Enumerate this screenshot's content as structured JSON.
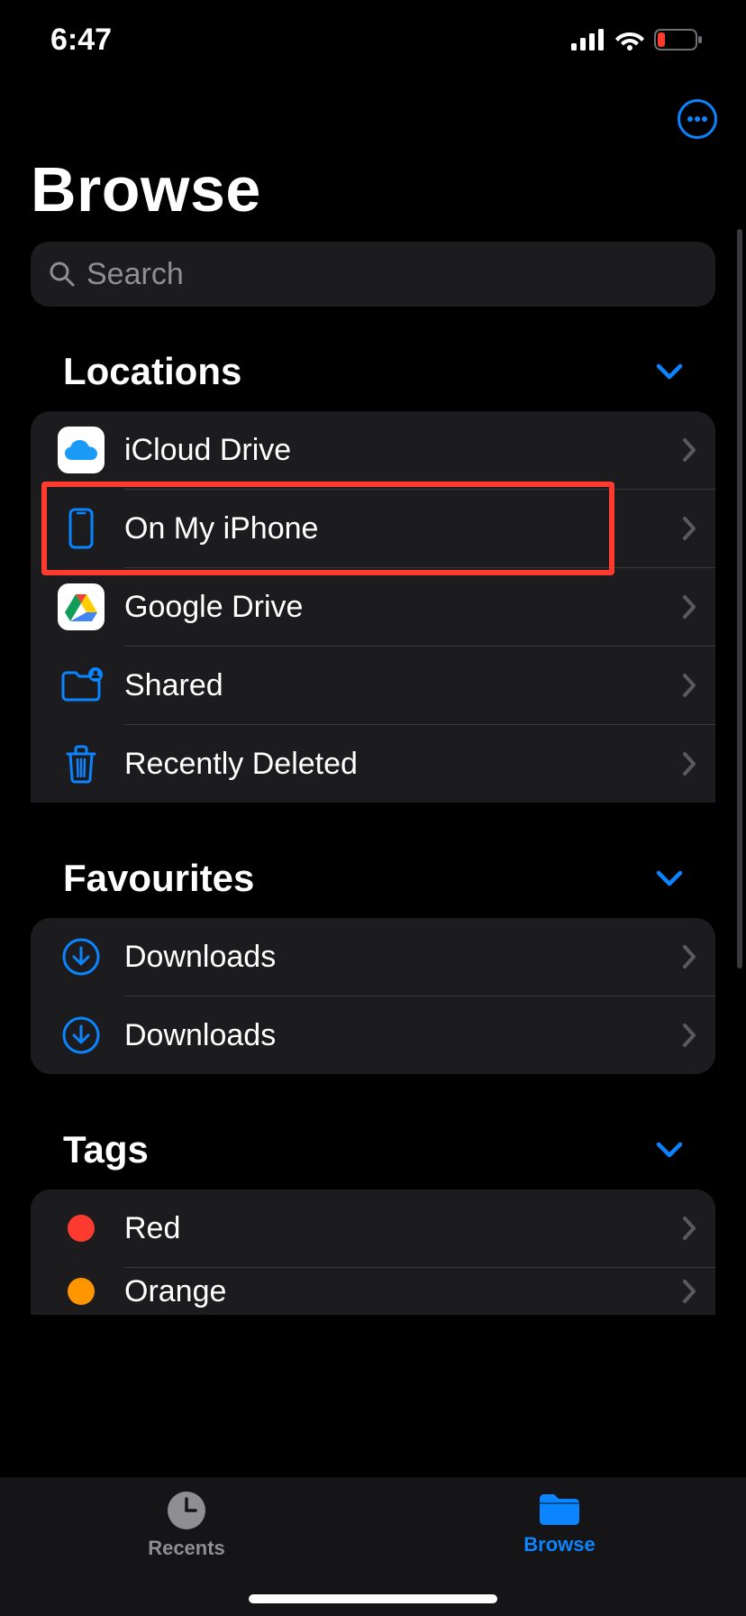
{
  "status": {
    "time": "6:47"
  },
  "nav": {
    "menu_icon": "more"
  },
  "title": "Browse",
  "search": {
    "placeholder": "Search"
  },
  "sections": {
    "locations": {
      "title": "Locations",
      "items": [
        {
          "label": "iCloud Drive",
          "icon": "icloud-app"
        },
        {
          "label": "On My iPhone",
          "icon": "iphone"
        },
        {
          "label": "Google Drive",
          "icon": "gdrive-app"
        },
        {
          "label": "Shared",
          "icon": "shared-folder"
        },
        {
          "label": "Recently Deleted",
          "icon": "trash"
        }
      ],
      "highlighted_index": 1
    },
    "favourites": {
      "title": "Favourites",
      "items": [
        {
          "label": "Downloads",
          "icon": "download"
        },
        {
          "label": "Downloads",
          "icon": "download"
        }
      ]
    },
    "tags": {
      "title": "Tags",
      "items": [
        {
          "label": "Red",
          "color": "#ff3b30"
        },
        {
          "label": "Orange",
          "color": "#ff9500"
        }
      ]
    }
  },
  "tabs": {
    "recents": "Recents",
    "browse": "Browse",
    "active": "browse"
  },
  "colors": {
    "accent": "#0a84ff",
    "card": "#1c1c1e",
    "text_secondary": "#8e8e93"
  }
}
